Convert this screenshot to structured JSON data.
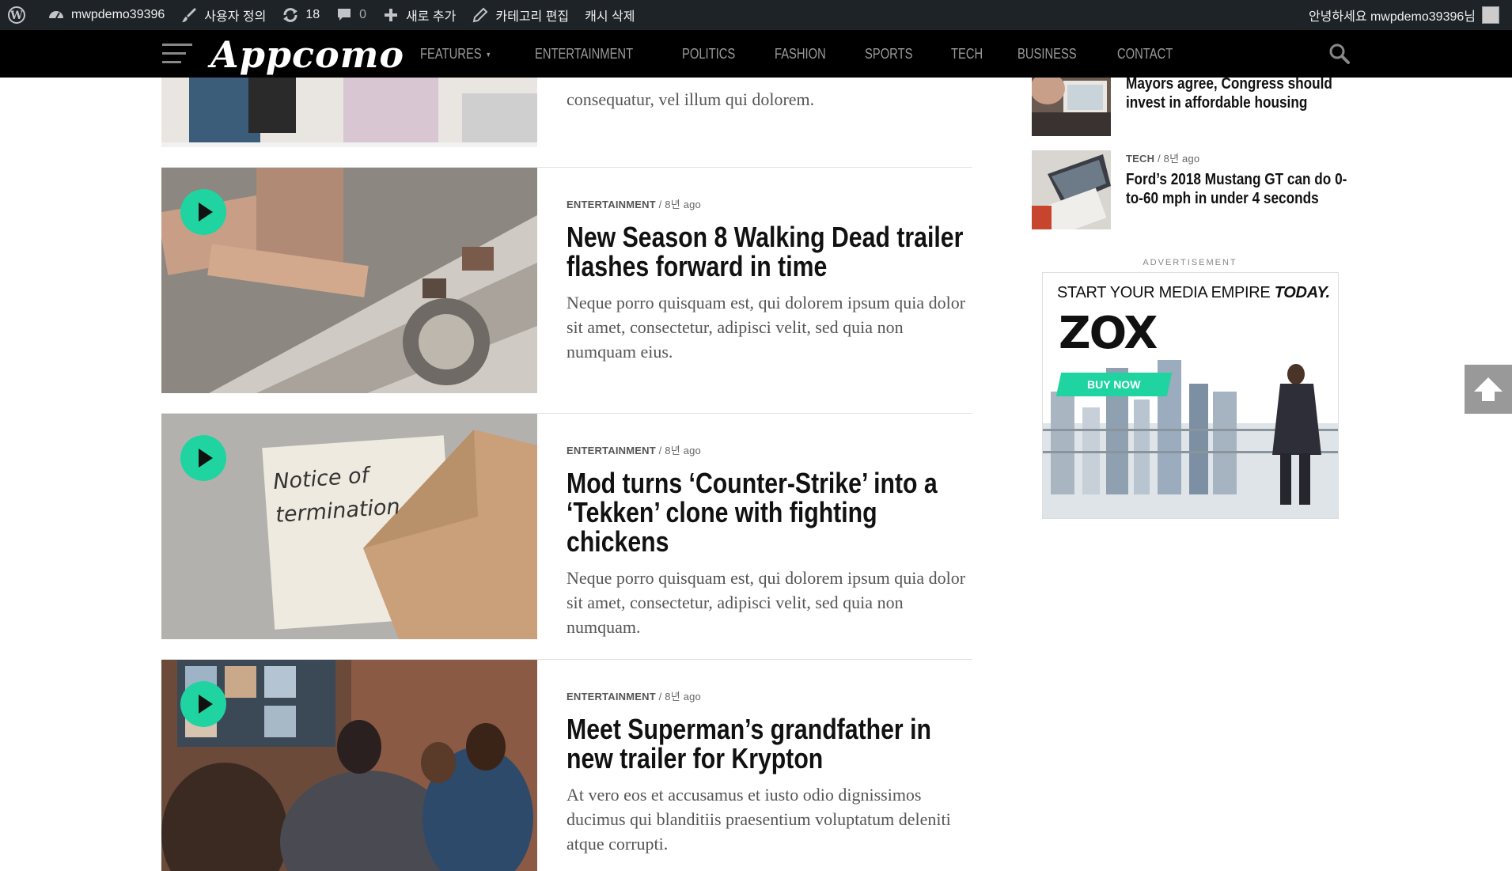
{
  "adminbar": {
    "site_name": "mwpdemo39396",
    "customize": "사용자 정의",
    "updates_count": "18",
    "comments_count": "0",
    "new": "새로 추가",
    "edit_category": "카테고리 편집",
    "clear_cache": "캐시 삭제",
    "greeting": "안녕하세요 mwpdemo39396님"
  },
  "nav": {
    "logo": "Appcomo",
    "links": [
      "FEATURES",
      "ENTERTAINMENT",
      "POLITICS",
      "FASHION",
      "SPORTS",
      "TECH",
      "BUSINESS",
      "CONTACT"
    ]
  },
  "articles": [
    {
      "category": "",
      "age": "",
      "title": "",
      "excerpt": "consequatur, vel illum qui dolorem."
    },
    {
      "category": "ENTERTAINMENT",
      "age": "8년 ago",
      "title": "New Season 8 Walking Dead trailer flashes forward in time",
      "excerpt": "Neque porro quisquam est, qui dolorem ipsum quia dolor sit amet, consectetur, adipisci velit, sed quia non numquam eius."
    },
    {
      "category": "ENTERTAINMENT",
      "age": "8년 ago",
      "title": "Mod turns ‘Counter-Strike’ into a ‘Tekken’ clone with fighting chickens",
      "excerpt": "Neque porro quisquam est, qui dolorem ipsum quia dolor sit amet, consectetur, adipisci velit, sed quia non numquam.",
      "thumb_text_1": "Notice of",
      "thumb_text_2": "termination"
    },
    {
      "category": "ENTERTAINMENT",
      "age": "8년 ago",
      "title": "Meet Superman’s grandfather in new trailer for Krypton",
      "excerpt": "At vero eos et accusamus et iusto odio dignissimos ducimus qui blanditiis praesentium voluptatum deleniti atque corrupti."
    }
  ],
  "sidebar": {
    "items": [
      {
        "category": "",
        "age": "",
        "title": "Mayors agree, Congress should invest in affordable housing"
      },
      {
        "category": "TECH",
        "age": "8년 ago",
        "title": "Ford’s 2018 Mustang GT can do 0-to-60 mph in under 4 seconds"
      }
    ],
    "ad_label": "ADVERTISEMENT",
    "ad": {
      "headline_prefix": "START YOUR MEDIA EMPIRE",
      "headline_emphasis": "TODAY.",
      "brand": "ZOX",
      "button": "BUY NOW"
    }
  },
  "colors": {
    "accent": "#1fd4a0",
    "adminbar_bg": "#1d2327",
    "nav_bg": "#000000"
  }
}
